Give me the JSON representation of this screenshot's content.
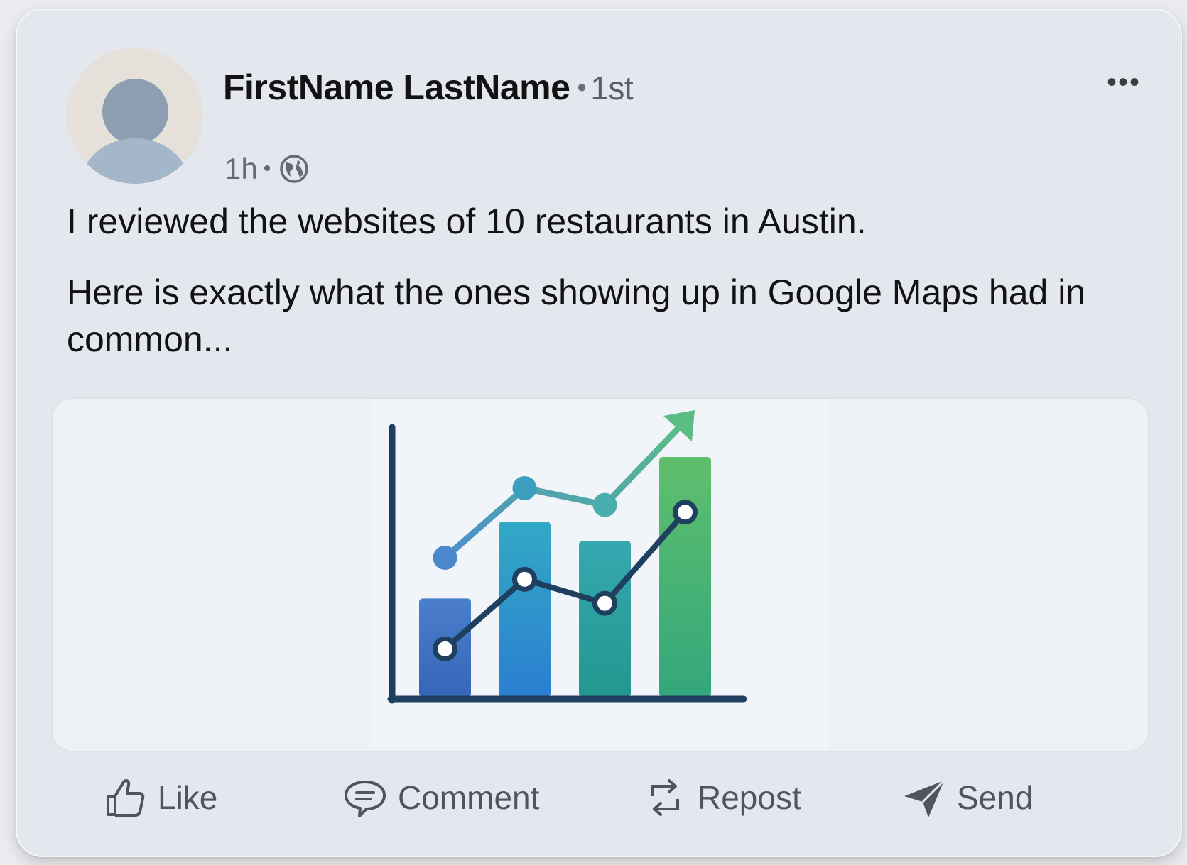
{
  "post": {
    "author": {
      "name": "FirstName LastName",
      "degree": "1st"
    },
    "time": "1h",
    "visibility_icon": "globe-icon",
    "more_icon": "more-horizontal-icon",
    "text": {
      "line1": "I reviewed the websites of 10 restaurants in Austin.",
      "line2": "Here is exactly what the ones showing up in Google Maps had in common..."
    }
  },
  "illustration": {
    "colors": {
      "bars": [
        "#3e78c6",
        "#2f97cf",
        "#2aa79b",
        "#49b86f"
      ],
      "upper_line": "#4aa2c0",
      "lower_line": "#1f3f5e",
      "arrow": "#5bbd84",
      "axis": "#1f3f5e"
    },
    "bar_levels": [
      0.41,
      0.73,
      0.65,
      1.0
    ],
    "lower_line_points": [
      0.2,
      0.49,
      0.39,
      0.77
    ],
    "upper_line_points": [
      0.58,
      0.87,
      0.8,
      1.0
    ]
  },
  "actions": {
    "like": "Like",
    "comment": "Comment",
    "repost": "Repost",
    "send": "Send"
  }
}
